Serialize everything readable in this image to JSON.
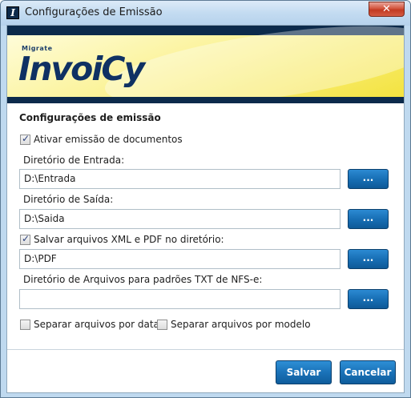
{
  "window": {
    "title": "Configurações de Emissão",
    "icon_glyph": "I",
    "close_glyph": "✕"
  },
  "banner": {
    "brand_small": "Migrate",
    "brand_main": "InvoiCy"
  },
  "form": {
    "section_title": "Configurações de emissão",
    "enable_emission": {
      "label": "Ativar emissão de documentos",
      "checked": true
    },
    "input_dir": {
      "label": "Diretório de Entrada:",
      "value": "D:\\Entrada"
    },
    "output_dir": {
      "label": "Diretório de Saída:",
      "value": "D:\\Saida"
    },
    "save_files": {
      "label": "Salvar arquivos XML e PDF no diretório:",
      "checked": true
    },
    "save_dir": {
      "value": "D:\\PDF"
    },
    "nfse_dir": {
      "label": "Diretório de Arquivos para padrões TXT de NFS-e:",
      "value": ""
    },
    "browse_label": "...",
    "separate_by_date": {
      "label": "Separar arquivos por data",
      "checked": false
    },
    "separate_by_model": {
      "label": "Separar arquivos por modelo",
      "checked": false
    }
  },
  "actions": {
    "save_label": "Salvar",
    "cancel_label": "Cancelar"
  },
  "colors": {
    "banner_navy": "#0c2a4b",
    "banner_yellow": "#f3e23a",
    "button_blue": "#1a72b8"
  }
}
